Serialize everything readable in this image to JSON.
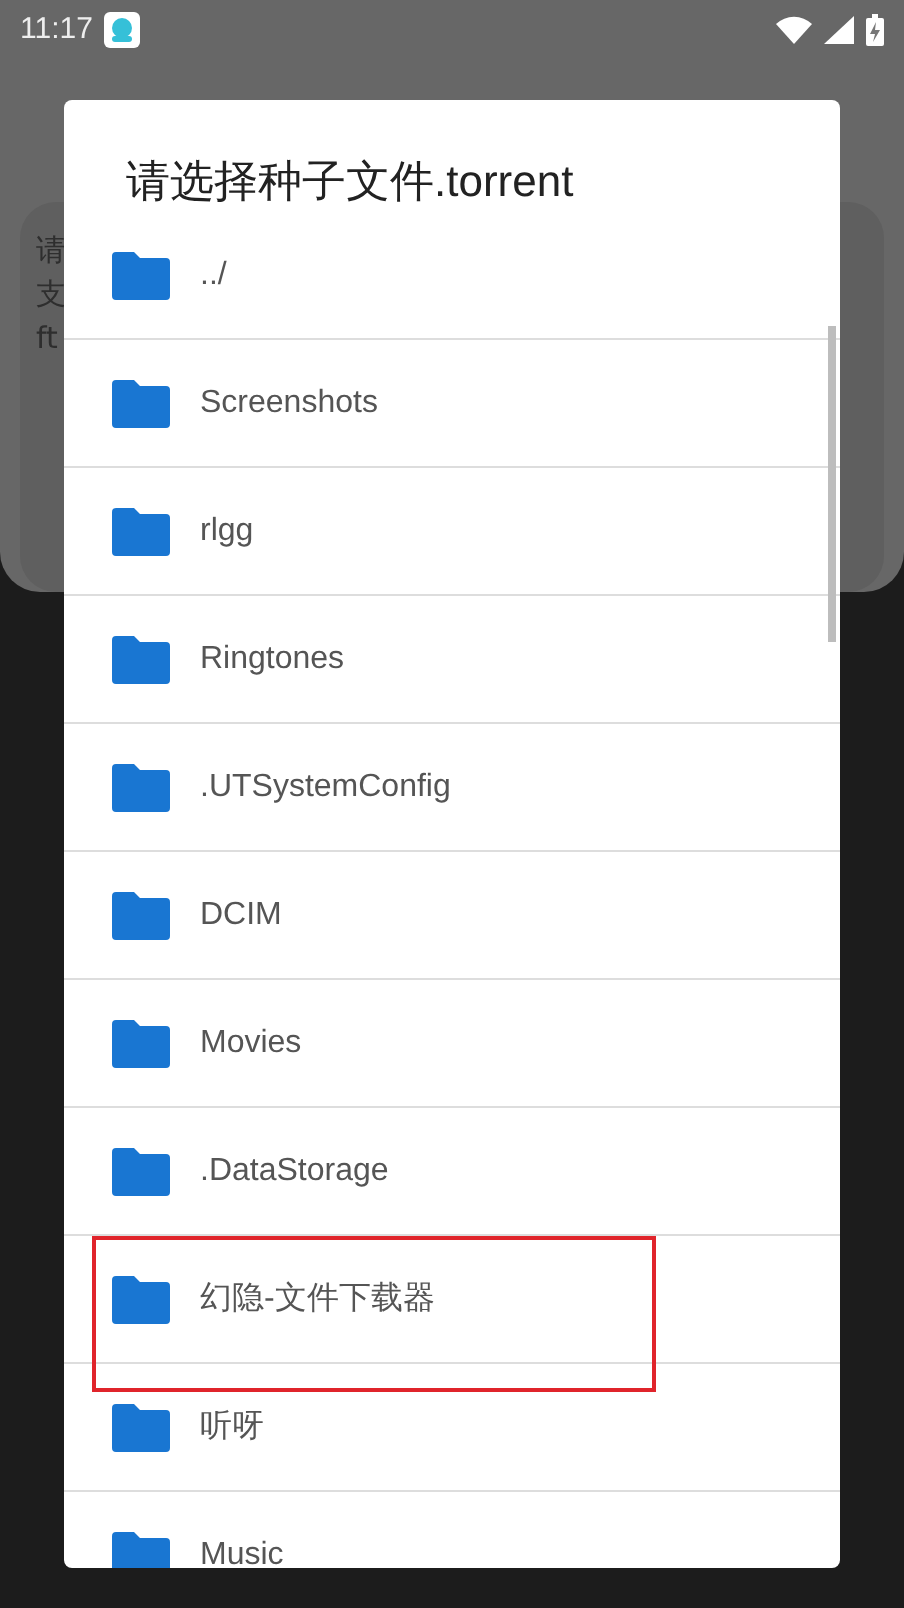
{
  "status_bar": {
    "time": "11:17"
  },
  "background_card": {
    "lines": [
      "请",
      "支",
      "ft"
    ]
  },
  "dialog": {
    "title": "请选择种子文件.torrent",
    "items": [
      {
        "name": "../",
        "highlighted": false
      },
      {
        "name": "Screenshots",
        "highlighted": false
      },
      {
        "name": "rlgg",
        "highlighted": false
      },
      {
        "name": "Ringtones",
        "highlighted": false
      },
      {
        "name": ".UTSystemConfig",
        "highlighted": false
      },
      {
        "name": "DCIM",
        "highlighted": false
      },
      {
        "name": "Movies",
        "highlighted": false
      },
      {
        "name": ".DataStorage",
        "highlighted": false
      },
      {
        "name": "幻隐-文件下载器",
        "highlighted": true
      },
      {
        "name": "听呀",
        "highlighted": false
      },
      {
        "name": "Music",
        "highlighted": false
      }
    ]
  }
}
